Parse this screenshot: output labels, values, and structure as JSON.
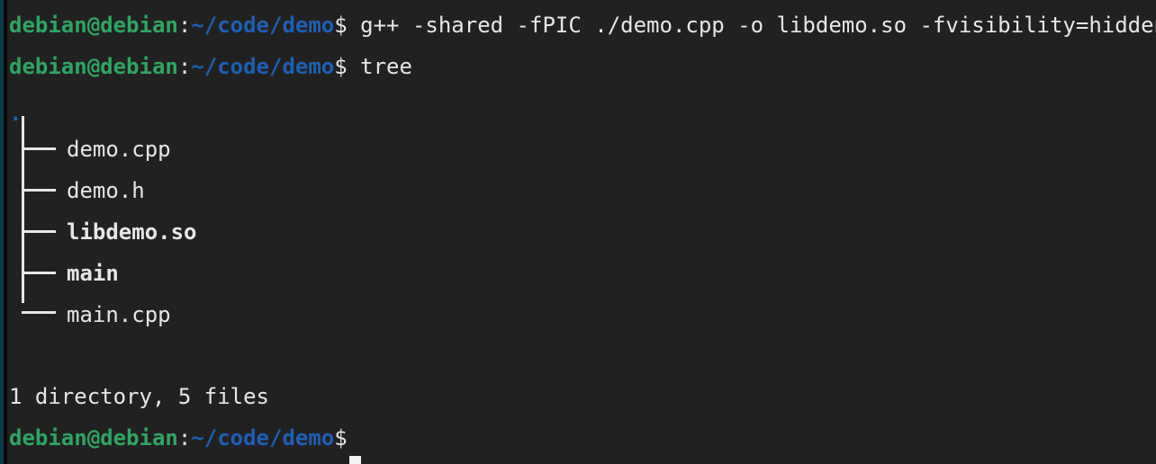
{
  "terminal": {
    "background_color": "#212121",
    "foreground_color": "#e6e6e6",
    "prompt_user_color": "#2ea562",
    "prompt_path_color": "#1d5fb4",
    "executable_color": "#2ea562",
    "edge_accent_color": "#0b3c4a"
  },
  "prompt": {
    "user_host": "debian@debian",
    "separator": ":",
    "path": "~/code/demo",
    "symbol": "$"
  },
  "commands": {
    "first": "g++ -shared -fPIC ./demo.cpp -o libdemo.so -fvisibility=hidden",
    "second": "tree"
  },
  "tree": {
    "root": ".",
    "entries": [
      {
        "connector": "branch",
        "name": "demo.cpp",
        "kind": "file"
      },
      {
        "connector": "branch",
        "name": "demo.h",
        "kind": "file"
      },
      {
        "connector": "branch",
        "name": "libdemo.so",
        "kind": "shared-object"
      },
      {
        "connector": "branch",
        "name": "main",
        "kind": "executable"
      },
      {
        "connector": "last",
        "name": "main.cpp",
        "kind": "file"
      }
    ],
    "summary": "1 directory, 5 files"
  },
  "cursor": {
    "shape": "block",
    "color": "#f2f2f2"
  }
}
